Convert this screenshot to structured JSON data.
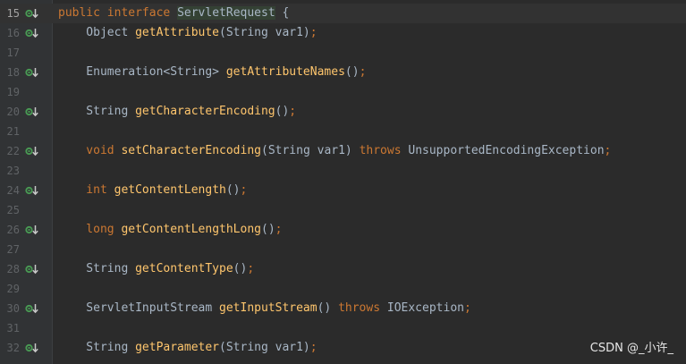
{
  "editor": {
    "lines": [
      {
        "num": "15",
        "impl": true,
        "tokens": [
          [
            "kw",
            "public"
          ],
          [
            "t",
            " "
          ],
          [
            "kw",
            "interface"
          ],
          [
            "t",
            " "
          ],
          [
            "hl",
            "ServletRequest"
          ],
          [
            "t",
            " {"
          ]
        ]
      },
      {
        "num": "16",
        "impl": true,
        "tokens": [
          [
            "t",
            "    Object "
          ],
          [
            "fn",
            "getAttribute"
          ],
          [
            "t",
            "(String var1)"
          ],
          [
            "kw",
            ";"
          ]
        ]
      },
      {
        "num": "17",
        "impl": false,
        "tokens": []
      },
      {
        "num": "18",
        "impl": true,
        "tokens": [
          [
            "t",
            "    Enumeration<String> "
          ],
          [
            "fn",
            "getAttributeNames"
          ],
          [
            "t",
            "()"
          ],
          [
            "kw",
            ";"
          ]
        ]
      },
      {
        "num": "19",
        "impl": false,
        "tokens": []
      },
      {
        "num": "20",
        "impl": true,
        "tokens": [
          [
            "t",
            "    String "
          ],
          [
            "fn",
            "getCharacterEncoding"
          ],
          [
            "t",
            "()"
          ],
          [
            "kw",
            ";"
          ]
        ]
      },
      {
        "num": "21",
        "impl": false,
        "tokens": []
      },
      {
        "num": "22",
        "impl": true,
        "tokens": [
          [
            "kw",
            "    void "
          ],
          [
            "fn",
            "setCharacterEncoding"
          ],
          [
            "t",
            "(String var1) "
          ],
          [
            "kw",
            "throws"
          ],
          [
            "t",
            " UnsupportedEncodingException"
          ],
          [
            "kw",
            ";"
          ]
        ]
      },
      {
        "num": "23",
        "impl": false,
        "tokens": []
      },
      {
        "num": "24",
        "impl": true,
        "tokens": [
          [
            "kw",
            "    int "
          ],
          [
            "fn",
            "getContentLength"
          ],
          [
            "t",
            "()"
          ],
          [
            "kw",
            ";"
          ]
        ]
      },
      {
        "num": "25",
        "impl": false,
        "tokens": []
      },
      {
        "num": "26",
        "impl": true,
        "tokens": [
          [
            "kw",
            "    long "
          ],
          [
            "fn",
            "getContentLengthLong"
          ],
          [
            "t",
            "()"
          ],
          [
            "kw",
            ";"
          ]
        ]
      },
      {
        "num": "27",
        "impl": false,
        "tokens": []
      },
      {
        "num": "28",
        "impl": true,
        "tokens": [
          [
            "t",
            "    String "
          ],
          [
            "fn",
            "getContentType"
          ],
          [
            "t",
            "()"
          ],
          [
            "kw",
            ";"
          ]
        ]
      },
      {
        "num": "29",
        "impl": false,
        "tokens": []
      },
      {
        "num": "30",
        "impl": true,
        "tokens": [
          [
            "t",
            "    ServletInputStream "
          ],
          [
            "fn",
            "getInputStream"
          ],
          [
            "t",
            "() "
          ],
          [
            "kw",
            "throws"
          ],
          [
            "t",
            " IOException"
          ],
          [
            "kw",
            ";"
          ]
        ]
      },
      {
        "num": "31",
        "impl": false,
        "tokens": []
      },
      {
        "num": "32",
        "impl": true,
        "tokens": [
          [
            "t",
            "    String "
          ],
          [
            "fn",
            "getParameter"
          ],
          [
            "t",
            "(String var1)"
          ],
          [
            "kw",
            ";"
          ]
        ]
      }
    ],
    "current_line": "15"
  },
  "watermark": "CSDN @_小许_",
  "colors": {
    "background": "#2b2b2b",
    "gutter": "#313335",
    "keyword": "#cc7832",
    "method": "#ffc66d",
    "text": "#a9b7c6",
    "impl_icon": "#499c54"
  },
  "icons": {
    "implemented": "implemented-arrow-icon"
  }
}
